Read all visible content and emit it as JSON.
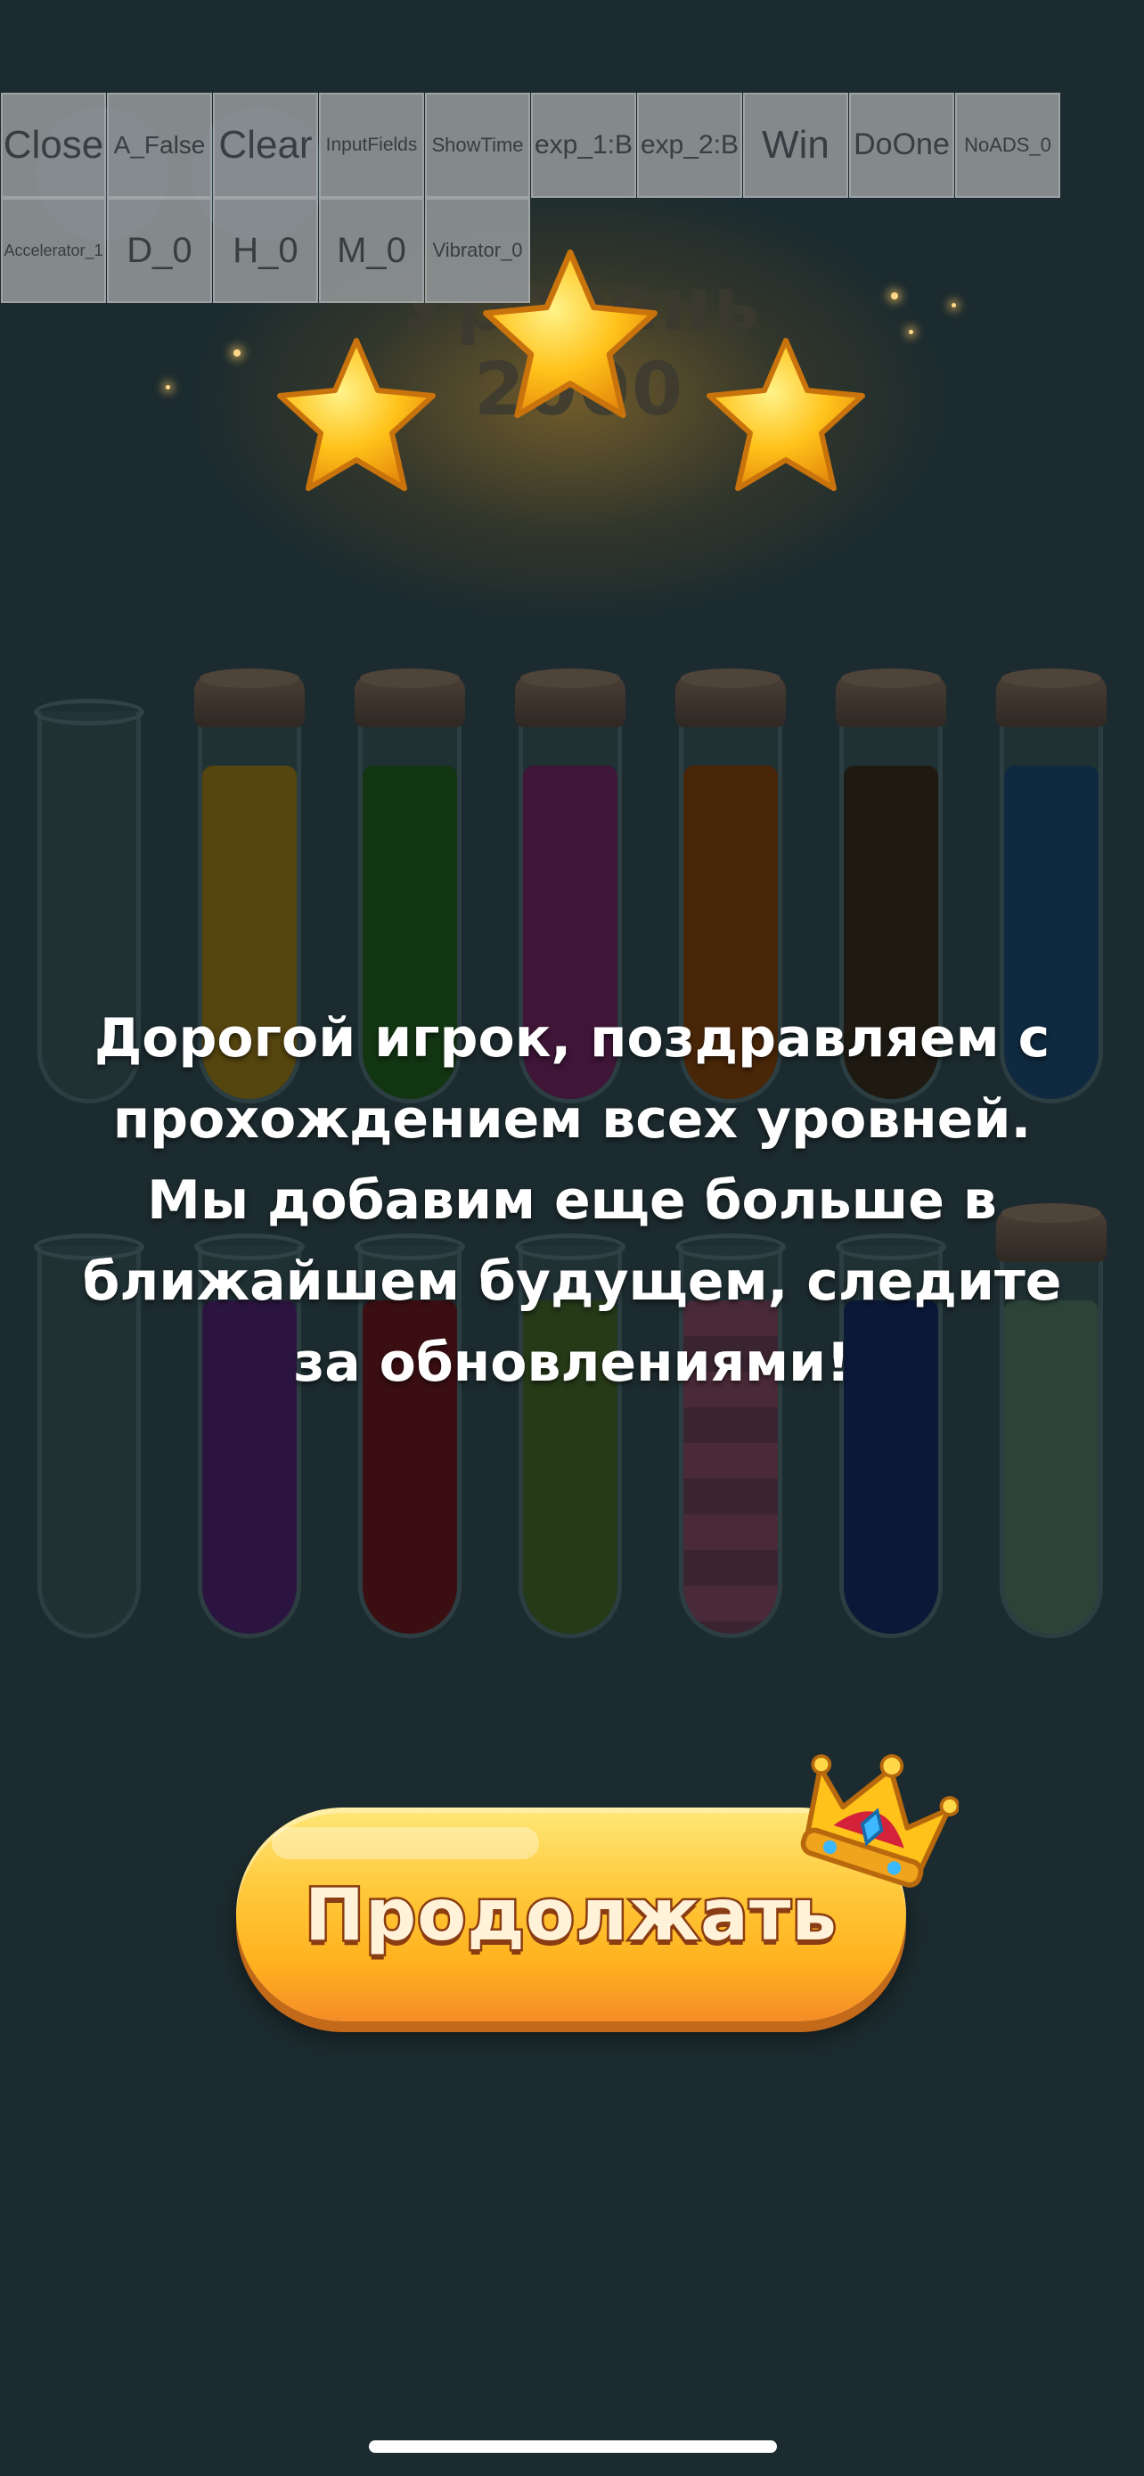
{
  "debug_buttons": [
    {
      "label": "Close",
      "size": 44
    },
    {
      "label": "A_False",
      "size": 28
    },
    {
      "label": "Clear",
      "size": 44
    },
    {
      "label": "InputFields",
      "size": 21
    },
    {
      "label": "ShowTime",
      "size": 22
    },
    {
      "label": "exp_1:B",
      "size": 30
    },
    {
      "label": "exp_2:B",
      "size": 30
    },
    {
      "label": "Win",
      "size": 44
    },
    {
      "label": "DoOne",
      "size": 34
    },
    {
      "label": "NoADS_0",
      "size": 22
    }
  ],
  "debug_buttons_row2": [
    {
      "label": "Accelerator_1",
      "size": 18
    },
    {
      "label": "D_0",
      "size": 40
    },
    {
      "label": "H_0",
      "size": 40
    },
    {
      "label": "M_0",
      "size": 40
    },
    {
      "label": "Vibrator_0",
      "size": 22
    }
  ],
  "level": {
    "title": "Уровень 2000",
    "stars_earned": 3,
    "stars_total": 3
  },
  "message": "Дорогой игрок, поздравляем с прохождением всех уровней. Мы добавим еще больше в ближайшем будущем, следите за обновлениями!",
  "continue_button": {
    "label": "Продолжать"
  },
  "colors": {
    "background": "#1c2b2f",
    "button_top": "#ffe87a",
    "button_bottom": "#f58c28",
    "star": "#ffc21a"
  },
  "tubes_row1": [
    {
      "corked": false,
      "color": null,
      "fill": 0
    },
    {
      "corked": true,
      "color": "#55450f",
      "fill": 0.85
    },
    {
      "corked": true,
      "color": "#123512",
      "fill": 0.85
    },
    {
      "corked": true,
      "color": "#3f1538",
      "fill": 0.85
    },
    {
      "corked": true,
      "color": "#4a2608",
      "fill": 0.85
    },
    {
      "corked": true,
      "color": "#1e1a12",
      "fill": 0.85
    },
    {
      "corked": true,
      "color": "#0f2a40",
      "fill": 0.85
    }
  ],
  "tubes_row2": [
    {
      "corked": false,
      "color": null,
      "fill": 0
    },
    {
      "corked": false,
      "color": "#2b1540",
      "fill": 0.85
    },
    {
      "corked": false,
      "color": "#3b0e12",
      "fill": 0.85
    },
    {
      "corked": false,
      "color": "#263a18",
      "fill": 0.85
    },
    {
      "corked": false,
      "color": "#4a2a38",
      "fill": 0.85,
      "striped": true
    },
    {
      "corked": false,
      "color": "#0c1838",
      "fill": 0.85
    },
    {
      "corked": true,
      "color": "#2c4438",
      "fill": 0.85
    }
  ]
}
